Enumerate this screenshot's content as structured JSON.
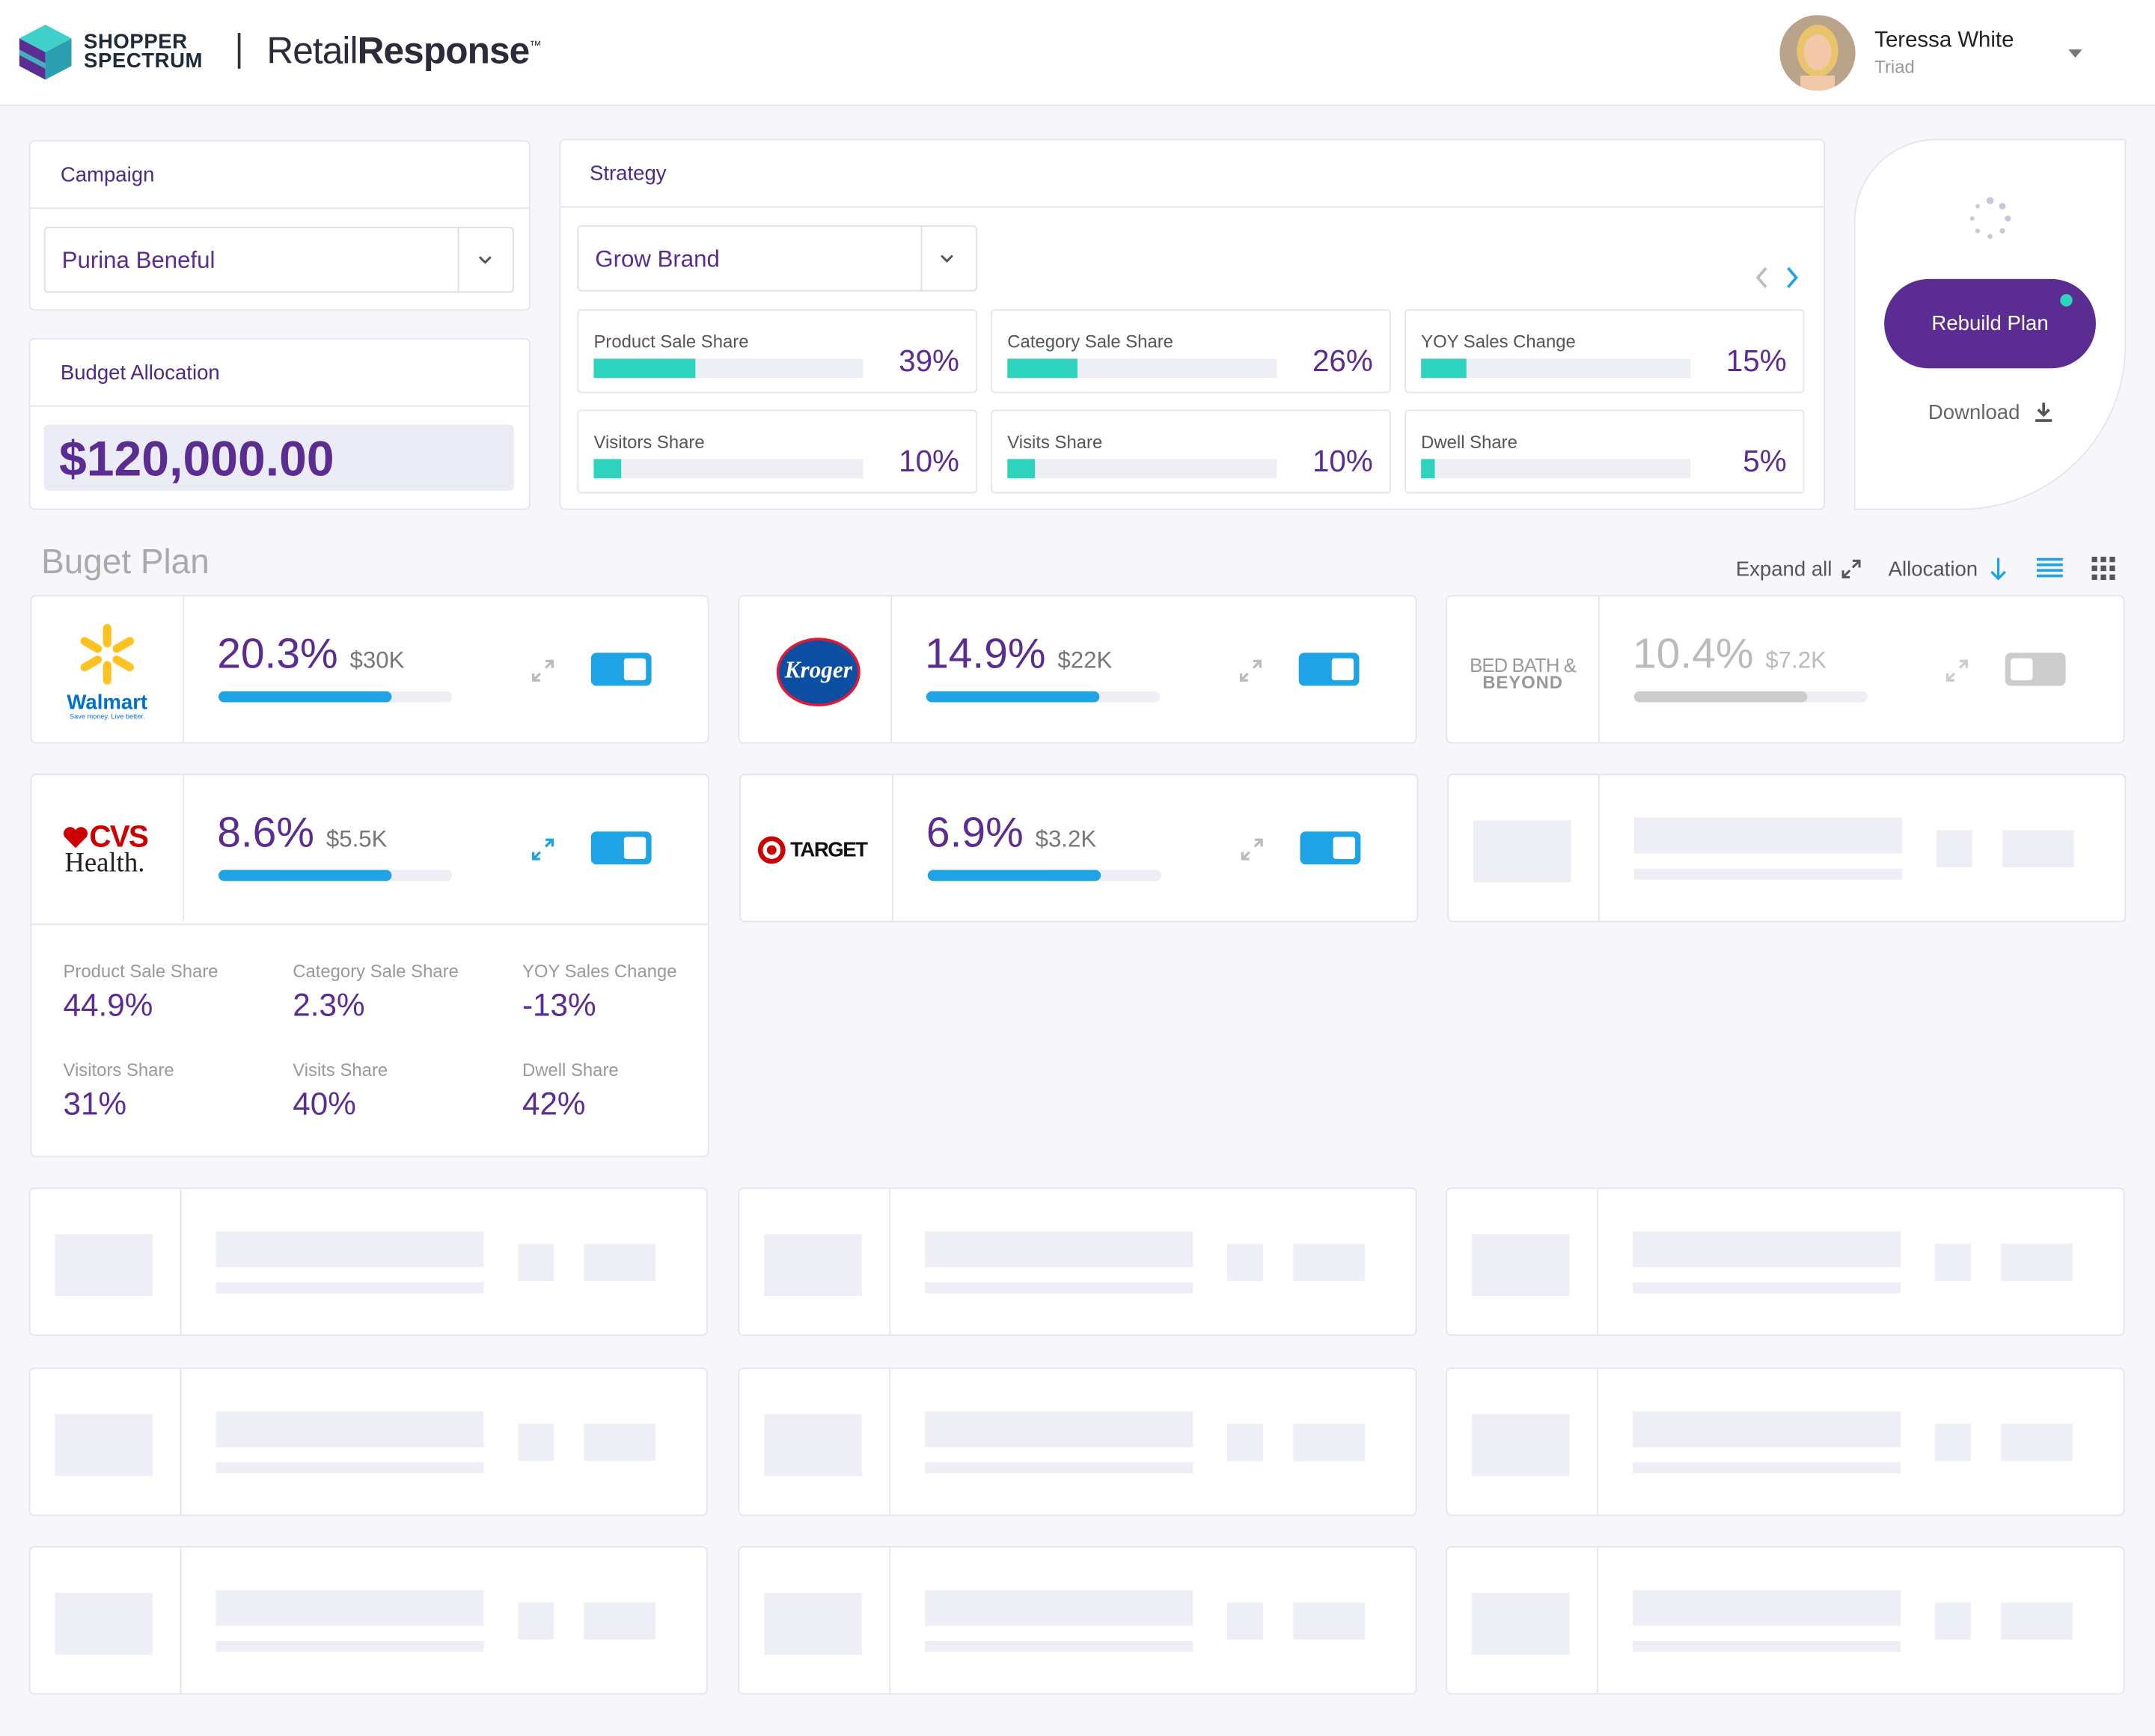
{
  "header": {
    "brand_line1": "SHOPPER",
    "brand_line2": "SPECTRUM",
    "product_light": "Retail",
    "product_bold": "Response",
    "product_tm": "™",
    "user": {
      "name": "Teressa White",
      "org": "Triad"
    }
  },
  "campaign": {
    "title": "Campaign",
    "selected": "Purina Beneful"
  },
  "budget": {
    "title": "Budget Allocation",
    "amount": "$120,000.00"
  },
  "strategy": {
    "title": "Strategy",
    "selected": "Grow Brand",
    "metrics": [
      {
        "label": "Product Sale Share",
        "value": "39%",
        "fill": 0.38
      },
      {
        "label": "Category Sale Share",
        "value": "26%",
        "fill": 0.26
      },
      {
        "label": "YOY Sales Change",
        "value": "15%",
        "fill": 0.17
      },
      {
        "label": "Visitors Share",
        "value": "10%",
        "fill": 0.1
      },
      {
        "label": "Visits Share",
        "value": "10%",
        "fill": 0.1
      },
      {
        "label": "Dwell Share",
        "value": "5%",
        "fill": 0.05
      }
    ]
  },
  "actions": {
    "rebuild_label": "Rebuild Plan",
    "download_label": "Download"
  },
  "plan": {
    "title": "Buget Plan",
    "expand_all": "Expand all",
    "sort_label": "Allocation",
    "retailers": [
      {
        "name": "Walmart",
        "tagline": "Save money. Live better.",
        "pct": "20.3%",
        "amount": "$30K",
        "fill": 0.74,
        "enabled": true
      },
      {
        "name": "Kroger",
        "pct": "14.9%",
        "amount": "$22K",
        "fill": 0.74,
        "enabled": true
      },
      {
        "name": "BED BATH & BEYOND",
        "line1": "BED BATH &",
        "line2": "BEYOND",
        "pct": "10.4%",
        "amount": "$7.2K",
        "fill": 0.74,
        "enabled": false
      },
      {
        "name": "CVS Health",
        "line1": "CVS",
        "line2": "Health.",
        "pct": "8.6%",
        "amount": "$5.5K",
        "fill": 0.74,
        "enabled": true
      },
      {
        "name": "TARGET",
        "pct": "6.9%",
        "amount": "$3.2K",
        "fill": 0.74,
        "enabled": true
      }
    ],
    "details": [
      {
        "label": "Product Sale Share",
        "value": "44.9%"
      },
      {
        "label": "Category Sale Share",
        "value": "2.3%"
      },
      {
        "label": "YOY Sales Change",
        "value": "-13%"
      },
      {
        "label": "Visitors Share",
        "value": "31%"
      },
      {
        "label": "Visits Share",
        "value": "40%"
      },
      {
        "label": "Dwell Share",
        "value": "42%"
      }
    ]
  },
  "colors": {
    "brand_purple": "#5b2c91",
    "accent_teal": "#2ed3be",
    "accent_blue": "#1ea3e6"
  },
  "icons": [
    "cube-logo-icon",
    "chevron-down-icon",
    "chevron-left-icon",
    "chevron-right-icon",
    "spinner-icon",
    "download-icon",
    "expand-icon",
    "sort-down-arrow-icon",
    "list-view-icon",
    "grid-view-icon"
  ]
}
